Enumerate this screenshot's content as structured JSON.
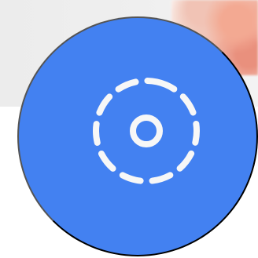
{
  "ui": {
    "accent_color": "#4381f1",
    "background_color": "#ffffff",
    "backdrop_color": "#eeeeee",
    "icon": "focus-target-icon"
  }
}
